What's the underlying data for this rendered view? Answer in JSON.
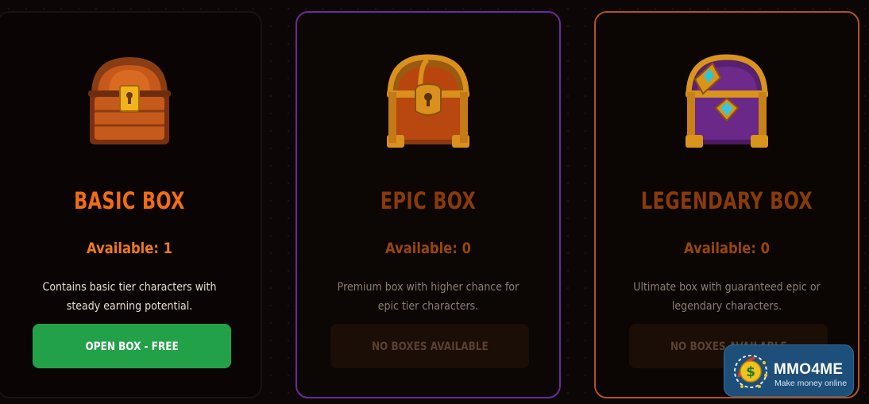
{
  "boxes": [
    {
      "title": "BASIC BOX",
      "available": "Available: 1",
      "description": "Contains basic tier characters with steady earning potential.",
      "button": "OPEN BOX - FREE",
      "chest_icon": "wooden-chest-icon"
    },
    {
      "title": "EPIC BOX",
      "available": "Available: 0",
      "description": "Premium box with higher chance for epic tier characters.",
      "button": "NO BOXES AVAILABLE",
      "chest_icon": "golden-chest-icon"
    },
    {
      "title": "LEGENDARY BOX",
      "available": "Available: 0",
      "description": "Ultimate box with guaranteed epic or legendary characters.",
      "button": "NO BOXES AVAILABLE",
      "chest_icon": "jeweled-chest-icon"
    }
  ],
  "watermark": {
    "name": "MMO4ME",
    "tagline": "Make money online",
    "icon": "dollar-coin-icon"
  },
  "colors": {
    "basic_accent": "#f26d12",
    "epic_border": "#6a2a9a",
    "legendary_border": "#b0541c",
    "open_button": "#23a148",
    "watermark_bg": "#1d4f7a"
  }
}
